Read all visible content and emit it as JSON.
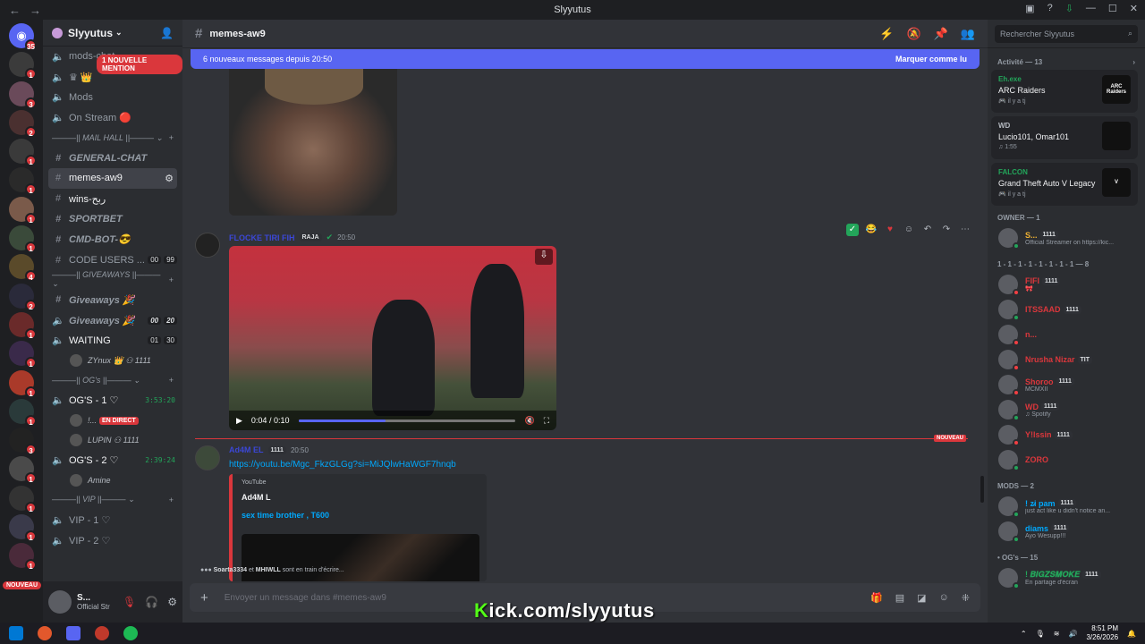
{
  "window": {
    "title": "Slyyutus"
  },
  "guilds": {
    "badges": [
      "35",
      "1",
      "3",
      "2",
      "1",
      "1",
      "1",
      "1",
      "4",
      "2",
      "1",
      "1",
      "1",
      "1",
      "3",
      "1",
      "1",
      "1",
      "1"
    ],
    "nouveau": "NOUVEAU"
  },
  "server": {
    "name": "Slyyutus",
    "mention_pill": "1 NOUVELLE MENTION"
  },
  "channels": [
    {
      "icon": "speaker",
      "name": "mods-chat",
      "kind": "voice"
    },
    {
      "icon": "speaker",
      "name": "♛ 👑",
      "kind": "voice"
    },
    {
      "icon": "speaker",
      "name": "Mods",
      "kind": "voice"
    },
    {
      "icon": "speaker",
      "name": "On Stream 🔴",
      "kind": "voice"
    },
    {
      "category": "MAIL HALL"
    },
    {
      "icon": "hash",
      "name": "GENERAL-CHAT",
      "kind": "text",
      "style": "it"
    },
    {
      "icon": "hash",
      "name": "memes-aw9",
      "kind": "text",
      "selected": true
    },
    {
      "icon": "hash",
      "name": "wins-ربح",
      "kind": "text",
      "unread": true
    },
    {
      "icon": "hash",
      "name": "SPORTBET",
      "kind": "text",
      "style": "it"
    },
    {
      "icon": "hash",
      "name": "CMD-BOT-😎",
      "kind": "text",
      "style": "it"
    },
    {
      "icon": "hash",
      "name": "CODE USERS ...",
      "kind": "text",
      "c1": "00",
      "c2": "99"
    },
    {
      "category": "GIVEAWAYS"
    },
    {
      "icon": "hash",
      "name": "Giveaways 🎉",
      "kind": "text",
      "style": "it"
    },
    {
      "icon": "speaker",
      "name": "Giveaways 🎉",
      "kind": "voice",
      "style": "it",
      "c1": "00",
      "c2": "20"
    },
    {
      "icon": "speaker",
      "name": "WAITING",
      "kind": "voice",
      "unread": true,
      "c1": "01",
      "c2": "30"
    },
    {
      "voiceuser": "ZYnux 👑 ⚇ 1111"
    },
    {
      "category": "OG's"
    },
    {
      "icon": "speaker",
      "name": "OG'S - 1 ♡",
      "kind": "voice",
      "unread": true,
      "timer": "3:53:20"
    },
    {
      "voiceuser": "!...",
      "live": "EN DIRECT"
    },
    {
      "voiceuser": "LUPIN ⚇ 1111"
    },
    {
      "icon": "speaker",
      "name": "OG'S - 2 ♡",
      "kind": "voice",
      "unread": true,
      "timer": "2:39:24"
    },
    {
      "voiceuser": "Amine"
    },
    {
      "category": "VIP"
    },
    {
      "icon": "speaker",
      "name": "VIP - 1 ♡",
      "kind": "voice"
    },
    {
      "icon": "speaker",
      "name": "VIP - 2 ♡",
      "kind": "voice"
    }
  ],
  "user_panel": {
    "name": "S...",
    "status": "Official Str"
  },
  "channel_header": {
    "name": "memes-aw9"
  },
  "banner": {
    "text": "6 nouveaux messages depuis 20:50",
    "action": "Marquer comme lu"
  },
  "messages": [
    {
      "author": "FLOCKE TIRI FIH",
      "tag": "RAJA",
      "time": "20:50",
      "color": "#3b47d6",
      "video": {
        "current": "0:04",
        "duration": "0:10",
        "progress": 0.4
      }
    },
    {
      "author": "Ad4M EL",
      "tag": "1111",
      "time": "20:50",
      "color": "#3b47d6",
      "link": "https://youtu.be/Mgc_FkzGLGg?si=MiJQlwHaWGF7hnqb",
      "embed": {
        "provider": "YouTube",
        "author": "Ad4M L",
        "title": "sex time brother , T600"
      }
    }
  ],
  "new_label": "NOUVEAU",
  "typing": {
    "users": [
      "Soarta3334",
      "MHIWLL"
    ],
    "join": "et",
    "suffix": "sont en train d'écrire..."
  },
  "composer": {
    "placeholder": "Envoyer un message dans #memes-aw9"
  },
  "overlay": {
    "k": "K",
    "rest": "ick.com/slyyutus"
  },
  "members_panel": {
    "search_placeholder": "Rechercher Slyyutus",
    "activity_header": "Activité — 13",
    "activities": [
      {
        "who": "Eh.exe",
        "who_color": "#23a55a",
        "game": "ARC Raiders",
        "sub": "🎮 il y a tj",
        "art": "ARC Raiders"
      },
      {
        "who": "WD",
        "who_color": "#b5bac1",
        "game": "Lucio101, Omar101",
        "sub": "♫ 1:55",
        "art": ""
      },
      {
        "who": "FALCON",
        "who_color": "#23a55a",
        "game": "Grand Theft Auto V Legacy",
        "sub": "🎮 il y a tj",
        "art": "V"
      }
    ],
    "groups": [
      {
        "title": "OWNER — 1",
        "members": [
          {
            "name": "S...",
            "badge": "1111",
            "status": "Official Streamer on https://kic...",
            "color": "#f0b232",
            "dot": "on"
          }
        ]
      },
      {
        "title": "1 - 1 - 1 - 1 - 1 - 1 - 1 - 1 — 8",
        "members": [
          {
            "name": "FIFI",
            "badge": "1111",
            "status": "🎀",
            "color": "#da373c",
            "dot": "off"
          },
          {
            "name": "ITSSAAD",
            "badge": "1111",
            "status": "",
            "color": "#da373c",
            "dot": "on"
          },
          {
            "name": "n...",
            "badge": "",
            "status": "",
            "color": "#da373c",
            "dot": "off"
          },
          {
            "name": "Nrusha Nizar",
            "badge": "TIT",
            "status": "",
            "color": "#da373c",
            "dot": "off"
          },
          {
            "name": "Shoroo",
            "badge": "1111",
            "status": "MCMXII",
            "color": "#da373c",
            "dot": "off"
          },
          {
            "name": "WD",
            "badge": "1111",
            "status": "♫ Spotify",
            "color": "#da373c",
            "dot": "on"
          },
          {
            "name": "Y!lssin",
            "badge": "1111",
            "status": "",
            "color": "#da373c",
            "dot": "off"
          },
          {
            "name": "ZORO",
            "badge": "",
            "status": "",
            "color": "#da373c",
            "dot": "on"
          }
        ]
      },
      {
        "title": "MODS — 2",
        "members": [
          {
            "name": "! z̷i pam",
            "badge": "1111",
            "status": "just act like u didn't notice an...",
            "color": "#00a8fc",
            "dot": "on"
          },
          {
            "name": "diams",
            "badge": "1111",
            "status": "Ayo Wesupp!!!",
            "color": "#00a8fc",
            "dot": "on"
          }
        ]
      },
      {
        "title": "• OG's — 15",
        "members": [
          {
            "name": "! 𝑩𝑰𝑮𝒁𝑺𝑴𝑶𝑲𝑬",
            "badge": "1111",
            "status": "En partage d'écran",
            "color": "#23a55a",
            "dot": "on"
          }
        ]
      }
    ]
  },
  "taskbar": {
    "time": "8:51 PM",
    "date": "3/26/2026"
  }
}
